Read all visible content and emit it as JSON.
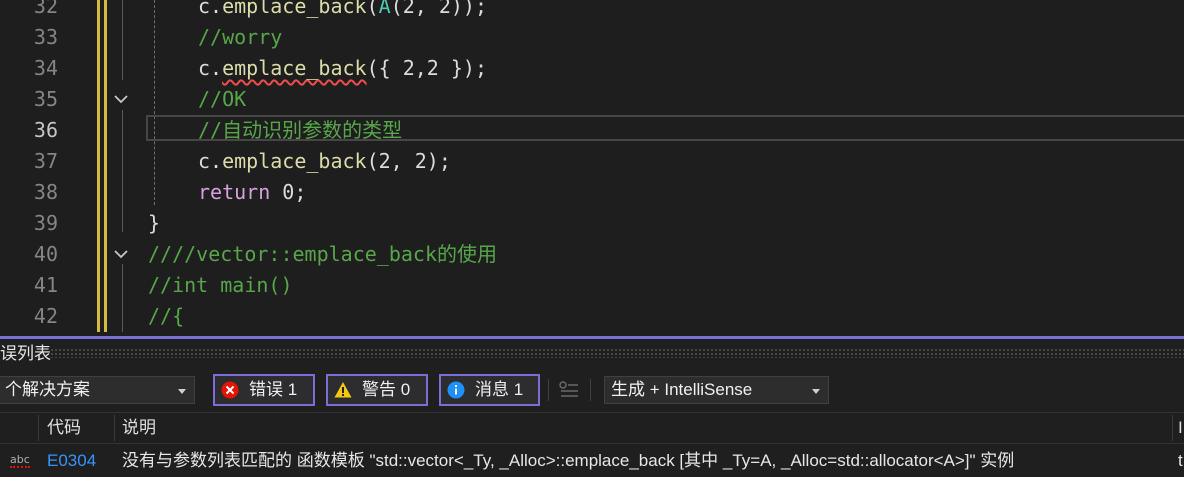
{
  "editor": {
    "lines": [
      {
        "num": "32",
        "parts": [
          {
            "t": "c.",
            "c": "tx"
          },
          {
            "t": "emplace_back",
            "c": "fn"
          },
          {
            "t": "(",
            "c": "tx"
          },
          {
            "t": "A",
            "c": "ty"
          },
          {
            "t": "(2, 2));",
            "c": "tx"
          }
        ]
      },
      {
        "num": "33",
        "parts": [
          {
            "t": "//worry",
            "c": "cm"
          }
        ]
      },
      {
        "num": "34",
        "parts": [
          {
            "t": "c.",
            "c": "tx"
          },
          {
            "t": "emplace_back",
            "c": "fn sq"
          },
          {
            "t": "({ 2,2 });",
            "c": "tx"
          }
        ]
      },
      {
        "num": "35",
        "parts": [
          {
            "t": "//OK",
            "c": "cm"
          }
        ]
      },
      {
        "num": "36",
        "parts": [
          {
            "t": "//自动识别参数的类型",
            "c": "cm"
          }
        ]
      },
      {
        "num": "37",
        "parts": [
          {
            "t": "c.",
            "c": "tx"
          },
          {
            "t": "emplace_back",
            "c": "fn"
          },
          {
            "t": "(2, 2);",
            "c": "tx"
          }
        ]
      },
      {
        "num": "38",
        "parts": [
          {
            "t": "return",
            "c": "kw"
          },
          {
            "t": " 0;",
            "c": "tx"
          }
        ]
      },
      {
        "num": "39",
        "parts": [
          {
            "t": "}",
            "c": "tx"
          }
        ]
      },
      {
        "num": "40",
        "parts": [
          {
            "t": "////vector::emplace_back的使用",
            "c": "cm"
          }
        ]
      },
      {
        "num": "41",
        "parts": [
          {
            "t": "//int main()",
            "c": "cm"
          }
        ]
      },
      {
        "num": "42",
        "parts": [
          {
            "t": "//{",
            "c": "cm"
          }
        ]
      }
    ],
    "current_line": "36"
  },
  "errorlist": {
    "title": "误列表",
    "scope_dropdown": "个解决方案",
    "errors_btn": "错误 1",
    "warnings_btn": "警告 0",
    "messages_btn": "消息 1",
    "build_dropdown": "生成 + IntelliSense",
    "columns": {
      "code": "代码",
      "desc": "说明",
      "right": "I"
    },
    "row": {
      "icon": "abc",
      "code": "E0304",
      "desc": "没有与参数列表匹配的 函数模板 \"std::vector<_Ty, _Alloc>::emplace_back [其中 _Ty=A, _Alloc=std::allocator<A>]\" 实例",
      "right": "t"
    }
  },
  "colors": {
    "accent": "#7b6fd6",
    "error": "#e51400",
    "warning": "#f2c811",
    "info": "#1e90ff"
  }
}
